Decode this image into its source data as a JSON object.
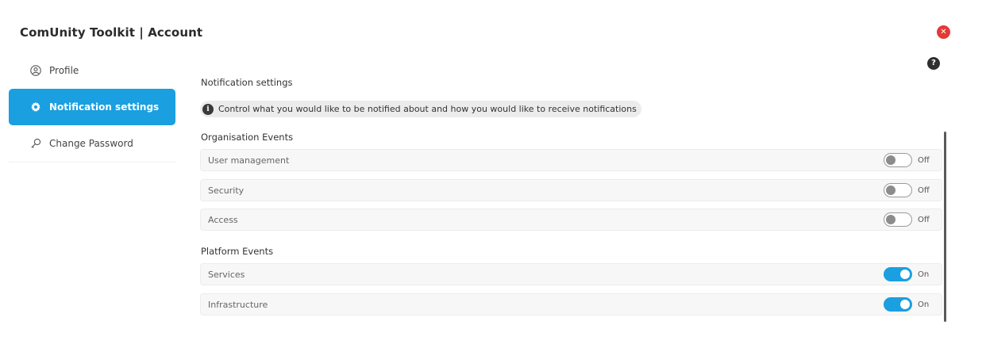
{
  "app": {
    "title": "ComUnity Toolkit | Account"
  },
  "controls": {
    "close_icon": "close-icon",
    "help_icon": "help-icon"
  },
  "sidebar": {
    "items": [
      {
        "label": "Profile",
        "icon": "user-circle-icon",
        "active": false
      },
      {
        "label": "Notification settings",
        "icon": "gear-icon",
        "active": true
      },
      {
        "label": "Change Password",
        "icon": "key-icon",
        "active": false
      }
    ]
  },
  "main": {
    "title": "Notification settings",
    "info": "Control what you would like to be notified about and how you would like to receive notifications",
    "groups": [
      {
        "title": "Organisation Events",
        "rows": [
          {
            "label": "User management",
            "state": "Off"
          },
          {
            "label": "Security",
            "state": "Off"
          },
          {
            "label": "Access",
            "state": "Off"
          }
        ]
      },
      {
        "title": "Platform Events",
        "rows": [
          {
            "label": "Services",
            "state": "On"
          },
          {
            "label": "Infrastructure",
            "state": "On"
          }
        ]
      }
    ]
  },
  "colors": {
    "accent": "#1a9fe0",
    "close": "#e53935",
    "help": "#2f2f2f"
  }
}
